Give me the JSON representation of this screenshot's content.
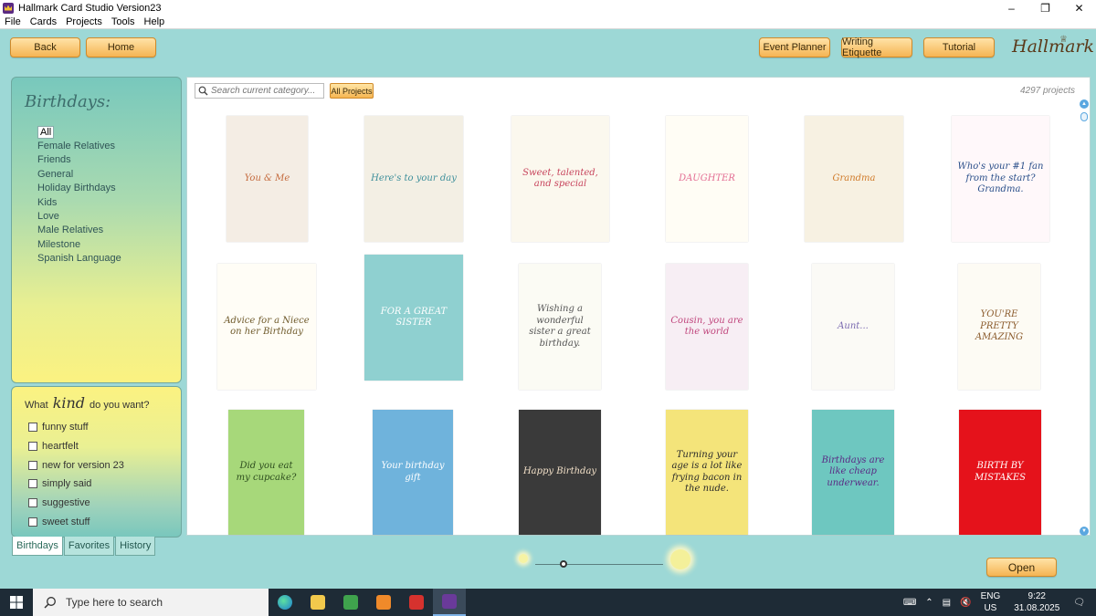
{
  "window": {
    "title": "Hallmark Card Studio Version23"
  },
  "menu": {
    "items": [
      "File",
      "Cards",
      "Projects",
      "Tools",
      "Help"
    ]
  },
  "toolbar": {
    "back": "Back",
    "home": "Home",
    "event_planner": "Event Planner",
    "writing_etiquette": "Writing Etiquette",
    "tutorial": "Tutorial",
    "logo": "Hallmark"
  },
  "categories": {
    "title": "Birthdays:",
    "items": [
      "All",
      "Female Relatives",
      "Friends",
      "General",
      "Holiday Birthdays",
      "Kids",
      "Love",
      "Male Relatives",
      "Milestone",
      "Spanish Language"
    ]
  },
  "kind": {
    "prefix": "What",
    "script": "kind",
    "suffix": "do you want?",
    "options": [
      "funny stuff",
      "heartfelt",
      "new for version 23",
      "simply said",
      "suggestive",
      "sweet stuff"
    ]
  },
  "tabs": [
    "Birthdays",
    "Favorites",
    "History"
  ],
  "search": {
    "placeholder": "Search current category...",
    "all_projects": "All Projects"
  },
  "project_count": "4297  projects",
  "cards": [
    {
      "text": "You & Me",
      "bg": "#f4ede4",
      "fg": "#c46a3d"
    },
    {
      "text": "Here's to your day",
      "bg": "#f3efe4",
      "fg": "#3e8f9b"
    },
    {
      "text": "Sweet, talented, and special",
      "bg": "#fbf8ee",
      "fg": "#c7445c"
    },
    {
      "text": "DAUGHTER",
      "bg": "#fffdf5",
      "fg": "#e36c92"
    },
    {
      "text": "Grandma",
      "bg": "#f7f1e2",
      "fg": "#d07b2a"
    },
    {
      "text": "Who's your #1 fan from the start? Grandma.",
      "bg": "#fff8fa",
      "fg": "#2a4f8a"
    },
    {
      "text": "Advice for a Niece on her Birthday",
      "bg": "#fffdf6",
      "fg": "#6f5a2b"
    },
    {
      "text": "FOR A GREAT SISTER",
      "bg": "#8fd0d0",
      "fg": "#ffffff"
    },
    {
      "text": "Wishing a wonderful sister a great birthday.",
      "bg": "#fbfbf4",
      "fg": "#555555"
    },
    {
      "text": "Cousin, you are the world",
      "bg": "#f7eef4",
      "fg": "#c0457c"
    },
    {
      "text": "Aunt...",
      "bg": "#fbfaf6",
      "fg": "#7a6ab0"
    },
    {
      "text": "YOU'RE PRETTY AMAZING",
      "bg": "#fdfbf4",
      "fg": "#8a5a2b"
    },
    {
      "text": "Did you eat my cupcake?",
      "bg": "#a7d87a",
      "fg": "#2d4d1e"
    },
    {
      "text": "Your birthday gift",
      "bg": "#6fb3dc",
      "fg": "#ffffff"
    },
    {
      "text": "Happy Birthday",
      "bg": "#3a3a3a",
      "fg": "#f2e0c8"
    },
    {
      "text": "Turning your age is a lot like frying bacon in the nude.",
      "bg": "#f4e47a",
      "fg": "#2a2a2a"
    },
    {
      "text": "Birthdays are like cheap underwear.",
      "bg": "#6ec7c0",
      "fg": "#5a2b84"
    },
    {
      "text": "BIRTH BY MISTAKES",
      "bg": "#e5121b",
      "fg": "#ffffff"
    }
  ],
  "open": "Open",
  "taskbar": {
    "search_placeholder": "Type here to search",
    "lang_top": "ENG",
    "lang_bottom": "US",
    "time": "9:22",
    "date": "31.08.2025"
  }
}
